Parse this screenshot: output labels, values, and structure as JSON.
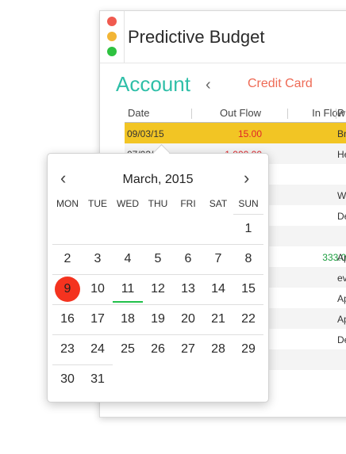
{
  "window": {
    "title": "Predictive Budget",
    "account_label": "Account",
    "account_name": "Credit Card"
  },
  "table": {
    "columns": [
      "Date",
      "Out Flow",
      "In Flow",
      "P"
    ],
    "rows": [
      {
        "date": "09/03/15",
        "out": "15.00",
        "in": "",
        "p": "Br",
        "selected": true
      },
      {
        "date": "07/03/15",
        "out": "1,000.00",
        "in": "",
        "p": "He",
        "selected": false
      },
      {
        "date": "",
        "out": "",
        "in": "",
        "p": "",
        "selected": false
      },
      {
        "date": "",
        "out": "",
        "in": "",
        "p": "W",
        "selected": false
      },
      {
        "date": "",
        "out": "",
        "in": "",
        "p": "De",
        "selected": false
      },
      {
        "date": "",
        "out": "",
        "in": "",
        "p": "",
        "selected": false
      },
      {
        "date": "",
        "out": "",
        "in": "333.00",
        "p": "Ap",
        "selected": false
      },
      {
        "date": "",
        "out": "",
        "in": "",
        "p": "ev",
        "selected": false
      },
      {
        "date": "",
        "out": "",
        "in": "",
        "p": "Ap",
        "selected": false
      },
      {
        "date": "",
        "out": "",
        "in": "",
        "p": "Ap",
        "selected": false
      },
      {
        "date": "",
        "out": "",
        "in": "",
        "p": "De",
        "selected": false
      },
      {
        "date": "",
        "out": "",
        "in": "",
        "p": "",
        "selected": false
      }
    ]
  },
  "calendar": {
    "month_label": "March, 2015",
    "prev_icon": "chevron-left-icon",
    "next_icon": "chevron-right-icon",
    "weekdays": [
      "MON",
      "TUE",
      "WED",
      "THU",
      "FRI",
      "SAT",
      "SUN"
    ],
    "weeks": [
      [
        "",
        "",
        "",
        "",
        "",
        "",
        "1"
      ],
      [
        "2",
        "3",
        "4",
        "5",
        "6",
        "7",
        "8"
      ],
      [
        "9",
        "10",
        "11",
        "12",
        "13",
        "14",
        "15"
      ],
      [
        "16",
        "17",
        "18",
        "19",
        "20",
        "21",
        "22"
      ],
      [
        "23",
        "24",
        "25",
        "26",
        "27",
        "28",
        "29"
      ],
      [
        "30",
        "31",
        "",
        "",
        "",
        "",
        ""
      ]
    ],
    "selected_day": "9",
    "today": "11",
    "colors": {
      "selected": "#f4331f",
      "today_underline": "#21c04a",
      "accent": "#2fbfa8"
    }
  }
}
